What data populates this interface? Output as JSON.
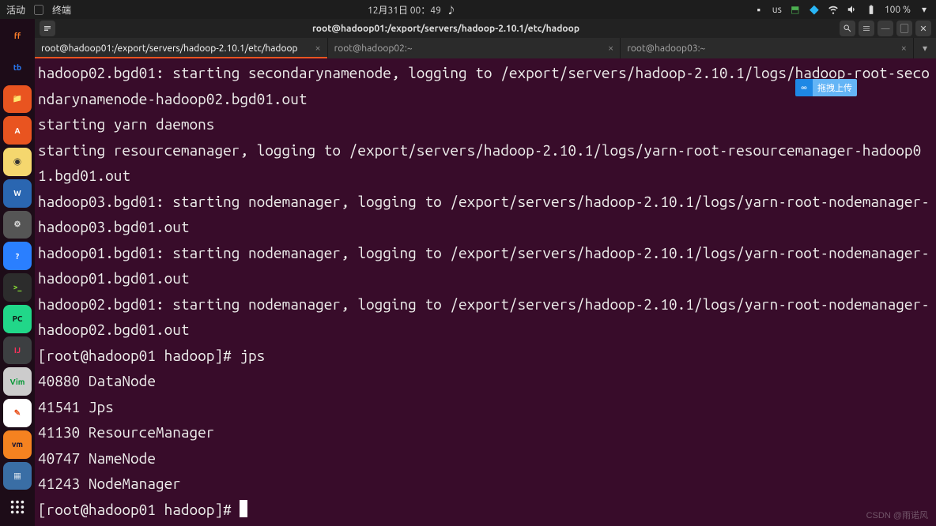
{
  "top_panel": {
    "activities": "活动",
    "app_label": "终端",
    "datetime": "12月31日 00：49",
    "input_method": "us",
    "battery": "100 %"
  },
  "window": {
    "title": "root@hadoop01:/export/servers/hadoop-2.10.1/etc/hadoop"
  },
  "tabs": [
    {
      "label": "root@hadoop01:/export/servers/hadoop-2.10.1/etc/hadoop",
      "active": true
    },
    {
      "label": "root@hadoop02:~",
      "active": false
    },
    {
      "label": "root@hadoop03:~",
      "active": false
    }
  ],
  "terminal_lines": [
    "hadoop02.bgd01: starting secondarynamenode, logging to /export/servers/hadoop-2.10.1/logs/hadoop-root-secondarynamenode-hadoop02.bgd01.out",
    "starting yarn daemons",
    "starting resourcemanager, logging to /export/servers/hadoop-2.10.1/logs/yarn-root-resourcemanager-hadoop01.bgd01.out",
    "hadoop03.bgd01: starting nodemanager, logging to /export/servers/hadoop-2.10.1/logs/yarn-root-nodemanager-hadoop03.bgd01.out",
    "hadoop01.bgd01: starting nodemanager, logging to /export/servers/hadoop-2.10.1/logs/yarn-root-nodemanager-hadoop01.bgd01.out",
    "hadoop02.bgd01: starting nodemanager, logging to /export/servers/hadoop-2.10.1/logs/yarn-root-nodemanager-hadoop02.bgd01.out",
    "[root@hadoop01 hadoop]# jps",
    "40880 DataNode",
    "41541 Jps",
    "41130 ResourceManager",
    "40747 NameNode",
    "41243 NodeManager",
    "[root@hadoop01 hadoop]# "
  ],
  "float_label": "拖拽上传",
  "watermark": "CSDN @雨诺风",
  "dock_apps": [
    {
      "name": "firefox",
      "bg": "transparent",
      "glyph": "ff",
      "color": "#ff7f2a"
    },
    {
      "name": "thunderbird",
      "bg": "transparent",
      "glyph": "tb",
      "color": "#2a7fff"
    },
    {
      "name": "files",
      "bg": "#e95420",
      "glyph": "📁",
      "color": "#fff"
    },
    {
      "name": "software",
      "bg": "#e95420",
      "glyph": "A",
      "color": "#fff"
    },
    {
      "name": "rhythmbox",
      "bg": "#f5d76e",
      "glyph": "◉",
      "color": "#333"
    },
    {
      "name": "libreoffice",
      "bg": "#2a66b1",
      "glyph": "W",
      "color": "#fff"
    },
    {
      "name": "settings",
      "bg": "#555",
      "glyph": "⚙",
      "color": "#ddd"
    },
    {
      "name": "help",
      "bg": "#2a7fff",
      "glyph": "?",
      "color": "#fff"
    },
    {
      "name": "terminal",
      "bg": "#2c2c2c",
      "glyph": ">_",
      "color": "#8ae234"
    },
    {
      "name": "pycharm",
      "bg": "#21d789",
      "glyph": "PC",
      "color": "#111"
    },
    {
      "name": "idea",
      "bg": "#3c3f41",
      "glyph": "IJ",
      "color": "#fe315d"
    },
    {
      "name": "vim",
      "bg": "#cccccc",
      "glyph": "Vim",
      "color": "#019833"
    },
    {
      "name": "text-editor",
      "bg": "#fff",
      "glyph": "✎",
      "color": "#e95420"
    },
    {
      "name": "vm",
      "bg": "#f58220",
      "glyph": "vm",
      "color": "#113"
    },
    {
      "name": "image-viewer",
      "bg": "#3a6ea5",
      "glyph": "▦",
      "color": "#fff"
    }
  ]
}
